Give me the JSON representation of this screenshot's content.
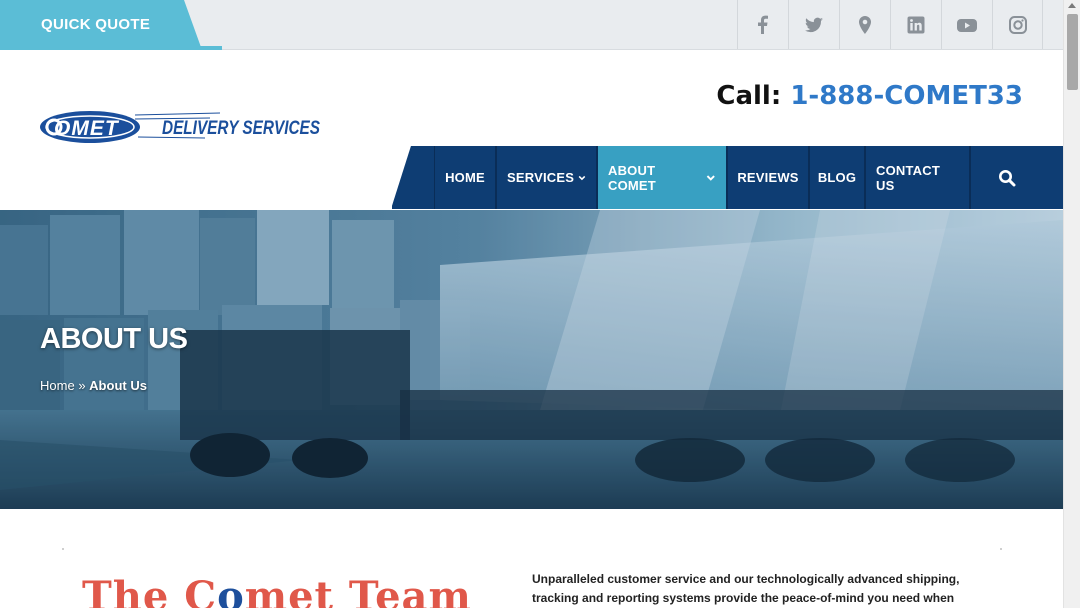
{
  "topbar": {
    "quote_label": "QUICK QUOTE",
    "social": [
      {
        "name": "facebook-icon"
      },
      {
        "name": "twitter-icon"
      },
      {
        "name": "location-pin-icon"
      },
      {
        "name": "linkedin-icon"
      },
      {
        "name": "youtube-icon"
      },
      {
        "name": "instagram-icon"
      }
    ]
  },
  "header": {
    "logo_text": "COMET DELIVERY SERVICES",
    "call_label": "Call:",
    "phone": "1-888-COMET33"
  },
  "nav": {
    "items": [
      {
        "label": "HOME",
        "dropdown": false
      },
      {
        "label": "SERVICES",
        "dropdown": true
      },
      {
        "label": "ABOUT COMET",
        "dropdown": true,
        "active": true
      },
      {
        "label": "REVIEWS",
        "dropdown": false
      },
      {
        "label": "BLOG",
        "dropdown": false
      },
      {
        "label": "CONTACT US",
        "dropdown": false
      }
    ],
    "search_icon": "search-icon"
  },
  "hero": {
    "title": "ABOUT US",
    "breadcrumb_home": "Home",
    "breadcrumb_sep": "»",
    "breadcrumb_current": "About Us"
  },
  "content": {
    "team_title_part1": "The C",
    "team_title_o": "o",
    "team_title_part2": "met Team",
    "intro_line1": "Unparalleled customer service and our technologically advanced shipping,",
    "intro_line2": "tracking and reporting systems provide the peace-of-mind you need when"
  },
  "colors": {
    "accent_teal": "#5bbdd6",
    "nav_blue": "#0e3d73",
    "active_teal": "#38a0c2",
    "phone_blue": "#2f79c8"
  }
}
